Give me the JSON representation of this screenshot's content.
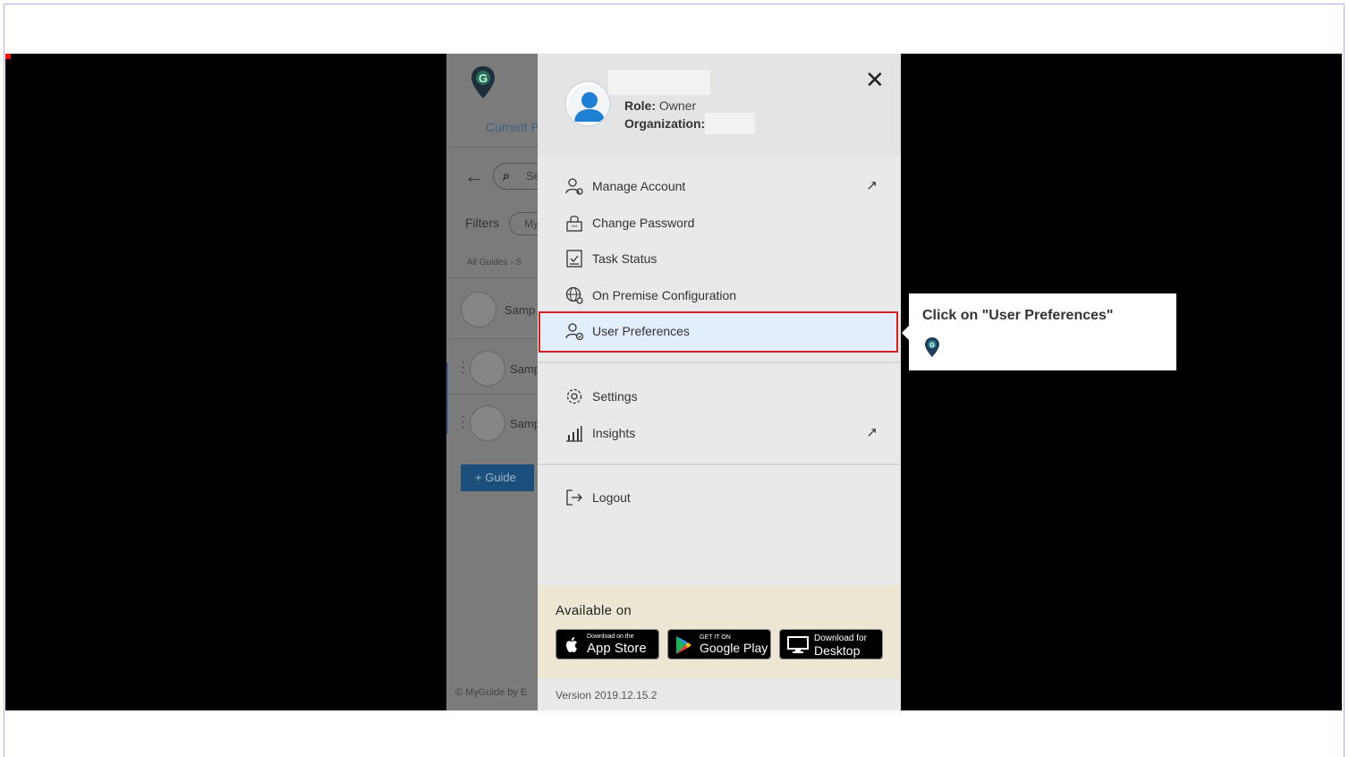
{
  "background_app": {
    "current_label": "Current P",
    "search_placeholder": "Se",
    "filters_label": "Filters",
    "filter_pill": "My",
    "breadcrumb": "All Guides  ›  S",
    "rows": [
      "Samp",
      "Samp",
      "Samp"
    ],
    "add_guide_button": "+ Guide",
    "footer": "© MyGuide by E"
  },
  "profile": {
    "role_label": "Role:",
    "role_value": "Owner",
    "org_label": "Organization:"
  },
  "menu": {
    "group1": [
      {
        "label": "Manage Account",
        "icon": "user-gear-icon",
        "external": true
      },
      {
        "label": "Change Password",
        "icon": "lock-icon",
        "external": false
      },
      {
        "label": "Task Status",
        "icon": "checklist-icon",
        "external": false
      },
      {
        "label": "On Premise Configuration",
        "icon": "globe-gear-icon",
        "external": false
      },
      {
        "label": "User Preferences",
        "icon": "user-check-icon",
        "external": false
      }
    ],
    "group2": [
      {
        "label": "Settings",
        "icon": "gear-icon",
        "external": false
      },
      {
        "label": "Insights",
        "icon": "bar-chart-icon",
        "external": true
      }
    ],
    "logout": "Logout",
    "external_glyph": "↗"
  },
  "available": {
    "title": "Available on",
    "appstore_small": "Download on the",
    "appstore_big": "App Store",
    "googleplay_small": "GET IT ON",
    "googleplay_big": "Google Play",
    "desktop_small": "Download for",
    "desktop_big": "Desktop"
  },
  "version": "Version 2019.12.15.2",
  "tooltip": {
    "text": "Click on \"User Preferences\""
  },
  "colors": {
    "highlight_border": "#d31f26",
    "brand": "#1f3d5c",
    "panel_bg": "#e9e9e9"
  }
}
